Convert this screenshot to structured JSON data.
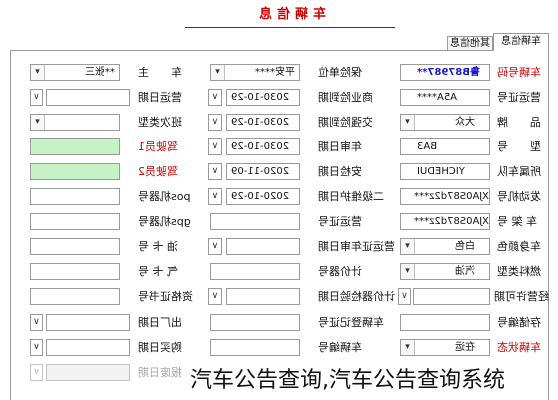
{
  "title": "车辆信息",
  "tabs": [
    {
      "label": "车辆信息",
      "active": true
    },
    {
      "label": "其他信息",
      "active": false
    }
  ],
  "watermark": "汽车公告查询,汽车公告查询系统",
  "colors": {
    "title": "#cc0000",
    "required_label": "#cc0000",
    "plate_value": "#1a1acc",
    "driver_fill": "#c6f2c6",
    "border": "#9a9a9a"
  },
  "icons": {
    "select_arrow": "chevron-down-icon",
    "date_toggle": "chevron-down-icon"
  },
  "rows": [
    [
      {
        "label": "车辆号码",
        "type": "text",
        "value": "鲁B87987**",
        "label_color": "#cc0000",
        "value_color": "#1a1acc",
        "value_bold": true
      },
      {
        "label": "保险单位",
        "type": "select",
        "value": "平安****"
      },
      {
        "label": "车　　主",
        "type": "select",
        "value": "**张三"
      }
    ],
    [
      {
        "label": "营运证号",
        "type": "text",
        "value": "A5A****"
      },
      {
        "label": "商业险到期",
        "type": "date",
        "value": "2030-10-29"
      },
      {
        "label": "营运日期",
        "type": "date",
        "value": ""
      }
    ],
    [
      {
        "label": "品　　牌",
        "type": "select",
        "value": "大众"
      },
      {
        "label": "交强险到期",
        "type": "date",
        "value": "2030-10-29"
      },
      {
        "label": "班次类型",
        "type": "select",
        "value": ""
      }
    ],
    [
      {
        "label": "型　　号",
        "type": "text",
        "value": "BA3"
      },
      {
        "label": "年审日期",
        "type": "date",
        "value": "2030-10-29"
      },
      {
        "label": "驾驶员1",
        "type": "text",
        "value": "",
        "label_color": "#cc0000",
        "fill": "#c6f2c6"
      }
    ],
    [
      {
        "label": "所属车队",
        "type": "text",
        "value": "YICHEDUI"
      },
      {
        "label": "安检日期",
        "type": "date",
        "value": "2020-11-09"
      },
      {
        "label": "驾驶员2",
        "type": "text",
        "value": "",
        "label_color": "#cc0000",
        "fill": "#c6f2c6"
      }
    ],
    [
      {
        "label": "发动机号",
        "type": "text",
        "value": "XJA0S87d2z***"
      },
      {
        "label": "二级维护日期",
        "type": "date",
        "value": "2020-10-29"
      },
      {
        "label": "pos机器号",
        "type": "text",
        "value": ""
      }
    ],
    [
      {
        "label": "车 架 号",
        "type": "text",
        "value": "XJA0S87d2z***"
      },
      {
        "label": "营运证号",
        "type": "text",
        "value": ""
      },
      {
        "label": "gps机器号",
        "type": "text",
        "value": ""
      }
    ],
    [
      {
        "label": "车身颜色",
        "type": "select",
        "value": "白色"
      },
      {
        "label": "营运证年审日期",
        "type": "date",
        "value": ""
      },
      {
        "label": "油 卡 号",
        "type": "text",
        "value": ""
      }
    ],
    [
      {
        "label": "燃料类型",
        "type": "select",
        "value": "汽油"
      },
      {
        "label": "计价器号",
        "type": "text",
        "value": ""
      },
      {
        "label": "气 卡 号",
        "type": "text",
        "value": ""
      }
    ],
    [
      {
        "label": "经营许可期",
        "type": "date",
        "value": ""
      },
      {
        "label": "计价器检验日期",
        "type": "date",
        "value": ""
      },
      {
        "label": "资格证书号",
        "type": "text",
        "value": ""
      }
    ],
    [
      {
        "label": "存储编号",
        "type": "text",
        "value": ""
      },
      {
        "label": "车辆登记证号",
        "type": "text",
        "value": ""
      },
      {
        "label": "出厂日期",
        "type": "date",
        "value": ""
      }
    ],
    [
      {
        "label": "车辆状态",
        "type": "select",
        "value": "在运",
        "label_color": "#cc0000"
      },
      {
        "label": "车辆编号",
        "type": "text",
        "value": ""
      },
      {
        "label": "购买日期",
        "type": "date",
        "value": ""
      }
    ],
    [
      null,
      null,
      {
        "label": "报废日期",
        "type": "date",
        "value": "",
        "disabled": true
      }
    ]
  ]
}
